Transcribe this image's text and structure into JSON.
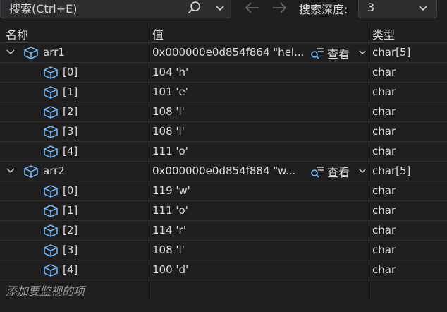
{
  "search": {
    "placeholder": "搜索(Ctrl+E)",
    "depth_label": "搜索深度:",
    "depth_value": "3"
  },
  "columns": {
    "name": "名称",
    "value": "值",
    "type": "类型"
  },
  "viewer_label": "查看",
  "rows": [
    {
      "name": "arr1",
      "value": "0x000000e0d854f864 \"hel...",
      "type": "char[5]"
    },
    {
      "name": "[0]",
      "value": "104 'h'",
      "type": "char"
    },
    {
      "name": "[1]",
      "value": "101 'e'",
      "type": "char"
    },
    {
      "name": "[2]",
      "value": "108 'l'",
      "type": "char"
    },
    {
      "name": "[3]",
      "value": "108 'l'",
      "type": "char"
    },
    {
      "name": "[4]",
      "value": "111 'o'",
      "type": "char"
    },
    {
      "name": "arr2",
      "value": "0x000000e0d854f884 \"w...",
      "type": "char[5]"
    },
    {
      "name": "[0]",
      "value": "119 'w'",
      "type": "char"
    },
    {
      "name": "[1]",
      "value": "111 'o'",
      "type": "char"
    },
    {
      "name": "[2]",
      "value": "114 'r'",
      "type": "char"
    },
    {
      "name": "[3]",
      "value": "108 'l'",
      "type": "char"
    },
    {
      "name": "[4]",
      "value": "100 'd'",
      "type": "char"
    }
  ],
  "add_watch_label": "添加要监视的项",
  "icons": {
    "cube": "cube-icon",
    "expand": "chevron-down-icon",
    "search": "search-icon",
    "viewer": "magnifier-icon"
  },
  "colors": {
    "cube_icon": "#75beff",
    "background": "#1f1f1f"
  }
}
